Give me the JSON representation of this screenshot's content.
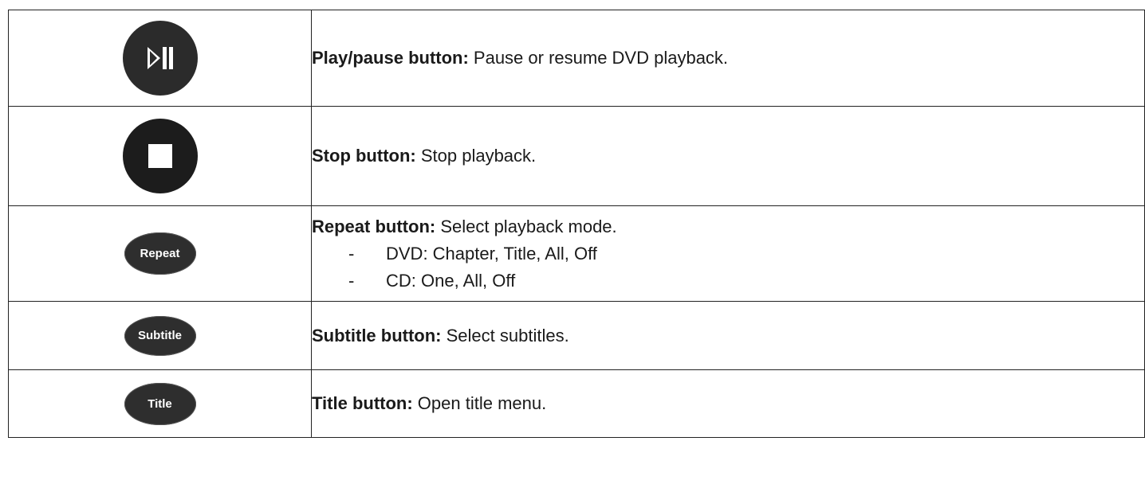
{
  "rows": [
    {
      "icon": "play-pause-icon",
      "name": "Play/pause button:",
      "desc": " Pause or resume DVD playback."
    },
    {
      "icon": "stop-icon",
      "name": "Stop button:",
      "desc": " Stop playback."
    },
    {
      "icon_label": "Repeat",
      "name": "Repeat button:",
      "desc": " Select playback mode.",
      "bullets": [
        {
          "dash": "-",
          "text": "DVD: Chapter, Title, All, Off"
        },
        {
          "dash": "-",
          "text": "CD: One, All, Off"
        }
      ]
    },
    {
      "icon_label": "Subtitle",
      "name": "Subtitle button:",
      "desc": " Select subtitles."
    },
    {
      "icon_label": "Title",
      "name": "Title button:",
      "desc": " Open title menu."
    }
  ],
  "colors": {
    "button_fill": "#2b2b2b",
    "button_text": "#ffffff",
    "border": "#222222"
  }
}
